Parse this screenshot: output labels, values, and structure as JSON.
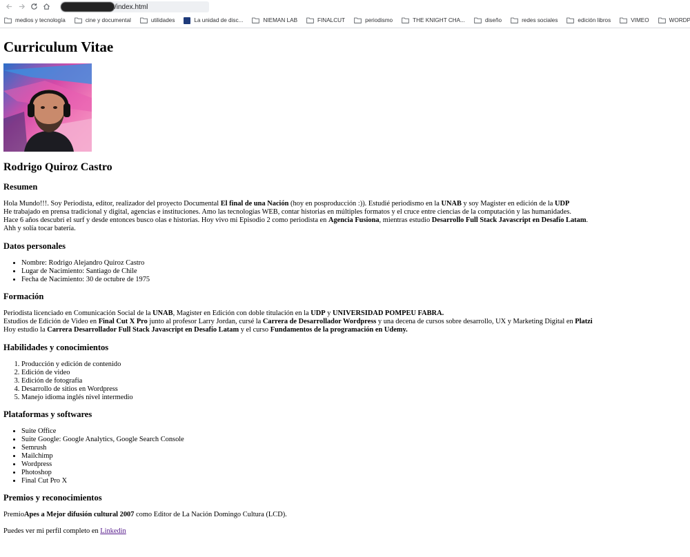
{
  "browser": {
    "url_suffix": "/index.html",
    "bookmarks": [
      {
        "label": "medios y tecnología",
        "icon": "folder-icon"
      },
      {
        "label": "cine y documental",
        "icon": "folder-icon"
      },
      {
        "label": "utilidades",
        "icon": "folder-icon"
      },
      {
        "label": "La unidad de disc...",
        "icon": "drive-favicon"
      },
      {
        "label": "NIEMAN LAB",
        "icon": "folder-icon"
      },
      {
        "label": "FINALCUT",
        "icon": "folder-icon"
      },
      {
        "label": "periodismo",
        "icon": "folder-icon"
      },
      {
        "label": "THE KNIGHT CHA...",
        "icon": "folder-icon"
      },
      {
        "label": "diseño",
        "icon": "folder-icon"
      },
      {
        "label": "redes sociales",
        "icon": "folder-icon"
      },
      {
        "label": "edición libros",
        "icon": "folder-icon"
      },
      {
        "label": "VIMEO",
        "icon": "folder-icon"
      },
      {
        "label": "WORDPRESS",
        "icon": "folder-icon"
      }
    ]
  },
  "page": {
    "title": "Curriculum Vitae",
    "name": "Rodrigo Quiroz Castro",
    "resumen": {
      "heading": "Resumen",
      "l1_a": "Hola Mundo!!!. Soy Periodista, editor, realizador del proyecto Documental ",
      "l1_b": "El final de una Nación",
      "l1_c": " (hoy en posproducción :)). Estudié periodismo en la ",
      "l1_d": "UNAB",
      "l1_e": " y soy Magister en edición de la ",
      "l1_f": "UDP",
      "l2": "He trabajado en prensa tradicional y digital, agencias e instituciones. Amo las tecnologías WEB, contar historias en múltiples formatos y el cruce entre ciencias de la computación y las humanidades.",
      "l3_a": "Hace 6 años descubrí el surf y desde entonces busco olas e historias. Hoy vivo mi Episodio 2 como periodista en ",
      "l3_b": "Agencia Fusiona",
      "l3_c": ", mientras estudio ",
      "l3_d": "Desarrollo Full Stack Javascript en Desafío Latam",
      "l3_e": ".",
      "l4": "Ahh y solía tocar batería."
    },
    "datos": {
      "heading": "Datos personales",
      "items": [
        "Nombre: Rodrigo Alejandro Quiroz Castro",
        "Lugar de Nacimiento: Santiago de Chile",
        "Fecha de Nacimiento: 30 de octubre de 1975"
      ]
    },
    "formacion": {
      "heading": "Formación",
      "l1_a": "Periodista licenciado en Comunicación Social de la ",
      "l1_b": "UNAB",
      "l1_c": ", Magister en Edición con doble titulación en la ",
      "l1_d": "UDP",
      "l1_e": " y ",
      "l1_f": "UNIVERSIDAD POMPEU FABRA.",
      "l2_a": "Estudios de Edición de Video en ",
      "l2_b": "Final Cut X Pro",
      "l2_c": " junto al profesor Larry Jordan, cursé la ",
      "l2_d": "Carrera de Desarrollador Wordpress",
      "l2_e": " y una decena de cursos sobre desarrollo, UX y Marketing Digital en ",
      "l2_f": "Platzi",
      "l3_a": "Hoy estudio la ",
      "l3_b": "Carrera Desarrollador Full Stack Javascript en Desafío Latam",
      "l3_c": " y el curso ",
      "l3_d": "Fundamentos de la programación en Udemy."
    },
    "habilidades": {
      "heading": "Habilidades y conocimientos",
      "items": [
        "Producción y edición de contenido",
        "Edición de video",
        "Edición de fotografía",
        "Desarrollo de sitios en Wordpress",
        "Manejo idioma inglés nivel intermedio"
      ]
    },
    "plataformas": {
      "heading": "Plataformas y softwares",
      "items": [
        "Suite Office",
        "Suite Google: Google Analytics, Google Search Console",
        "Semrush",
        "Mailchimp",
        "Wordpress",
        "Photoshop",
        "Final Cut Pro X"
      ]
    },
    "premios": {
      "heading": "Premios y reconocimientos",
      "p_a": "Premio",
      "p_b": "Apes a Mejor difusión cultural 2007",
      "p_c": " como Editor de La Nación Domingo Cultura (LCD)."
    },
    "perfil": {
      "text": "Puedes ver mi perfil completo en ",
      "link": "Linkedin"
    }
  }
}
